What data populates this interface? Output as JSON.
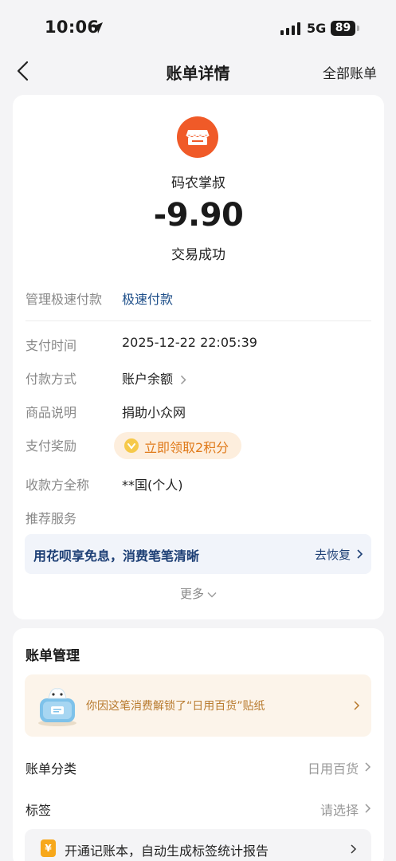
{
  "status_bar": {
    "time": "10:06",
    "network": "5G",
    "battery": "89"
  },
  "nav": {
    "title": "账单详情",
    "right_action": "全部账单"
  },
  "transaction": {
    "merchant": "码农掌叔",
    "amount": "-9.90",
    "status": "交易成功"
  },
  "manage_row": {
    "label": "管理极速付款",
    "value": "极速付款"
  },
  "details": {
    "pay_time_label": "支付时间",
    "pay_time": "2025-12-22 22:05:39",
    "pay_method_label": "付款方式",
    "pay_method": "账户余额",
    "item_desc_label": "商品说明",
    "item_desc": "捐助小众网",
    "reward_label": "支付奖励",
    "reward_text": "立即领取2积分",
    "payee_label": "收款方全称",
    "payee": "**国(个人)",
    "recommend_label": "推荐服务"
  },
  "promo": {
    "text": "用花呗享免息，消费笔笔清晰",
    "action": "去恢复"
  },
  "more": "更多",
  "bill_management": {
    "title": "账单管理",
    "sticker_text": "你因这笔消费解锁了“日用百货”贴纸",
    "category_label": "账单分类",
    "category_value": "日用百货",
    "tag_label": "标签",
    "tag_value": "请选择",
    "notebook_icon": "¥",
    "notebook_text": "开通记账本，自动生成标签统计报告"
  },
  "colors": {
    "brand_orange": "#f05a28",
    "link_blue": "#1d4e89",
    "reward_orange": "#e07a1a"
  }
}
